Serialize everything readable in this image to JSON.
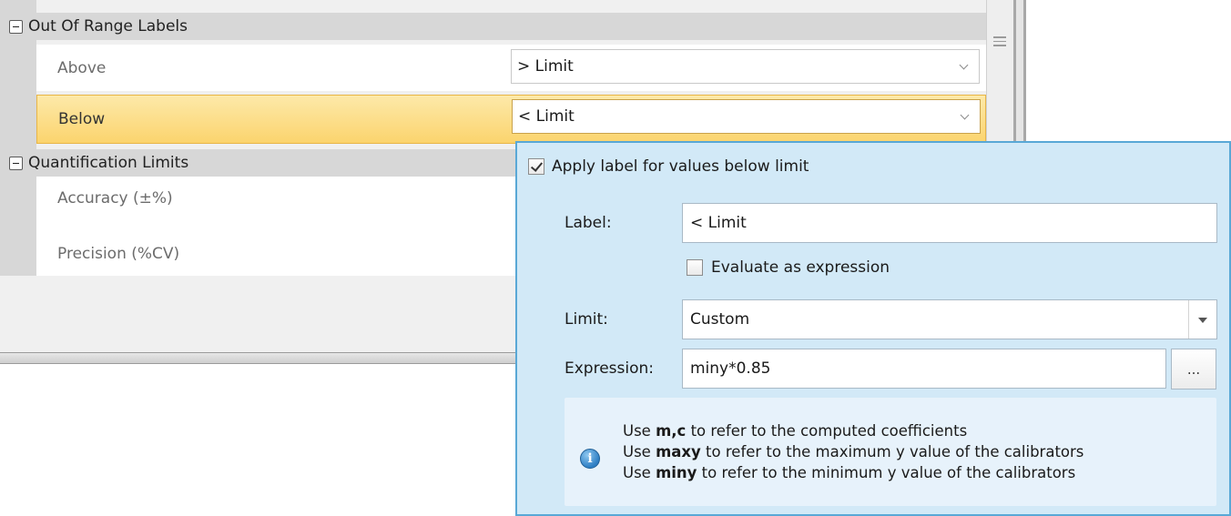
{
  "property_grid": {
    "categories": [
      {
        "label": "Out Of Range Labels",
        "rows": [
          {
            "name": "Above",
            "value": "> Limit"
          },
          {
            "name": "Below",
            "value": "< Limit"
          }
        ]
      },
      {
        "label": "Quantification Limits",
        "rows": [
          {
            "name": "Accuracy (±%)"
          },
          {
            "name": "Precision (%CV)"
          }
        ]
      }
    ]
  },
  "popup": {
    "apply_label": "Apply label for values below limit",
    "apply_checked": true,
    "label_field": {
      "label": "Label:",
      "value": "< Limit"
    },
    "evaluate_label": "Evaluate as expression",
    "evaluate_checked": false,
    "limit_field": {
      "label": "Limit:",
      "value": "Custom"
    },
    "expression_field": {
      "label": "Expression:",
      "value": "miny*0.85",
      "button_label": "..."
    },
    "info": {
      "line1": {
        "prefix": "Use ",
        "bold": "m,c",
        "suffix": " to refer to the computed coefficients"
      },
      "line2": {
        "prefix": "Use ",
        "bold": "maxy",
        "suffix": " to refer to the maximum y value of the calibrators"
      },
      "line3": {
        "prefix": "Use ",
        "bold": "miny",
        "suffix": " to refer to the minimum y value of the calibrators"
      }
    },
    "icon": "info-icon"
  }
}
